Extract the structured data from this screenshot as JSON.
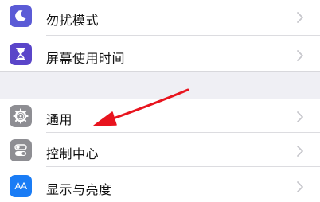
{
  "settings": {
    "group1": [
      {
        "label": "勿扰模式",
        "icon": "moon-icon",
        "icon_color": "#5b5bd6"
      },
      {
        "label": "屏幕使用时间",
        "icon": "hourglass-icon",
        "icon_color": "#5a45c9"
      }
    ],
    "group2": [
      {
        "label": "通用",
        "icon": "gear-icon",
        "icon_color": "#8e8e93"
      },
      {
        "label": "控制中心",
        "icon": "toggle-switches-icon",
        "icon_color": "#8e8e93"
      },
      {
        "label": "显示与亮度",
        "icon": "text-size-icon",
        "icon_color": "#1a7cf5",
        "icon_text": "AA"
      }
    ]
  },
  "annotation": {
    "arrow_color": "#e8141e",
    "points_to": "通用"
  },
  "colors": {
    "background": "#ffffff",
    "group_gap": "#efeff4",
    "chevron": "#c7c7cc"
  }
}
